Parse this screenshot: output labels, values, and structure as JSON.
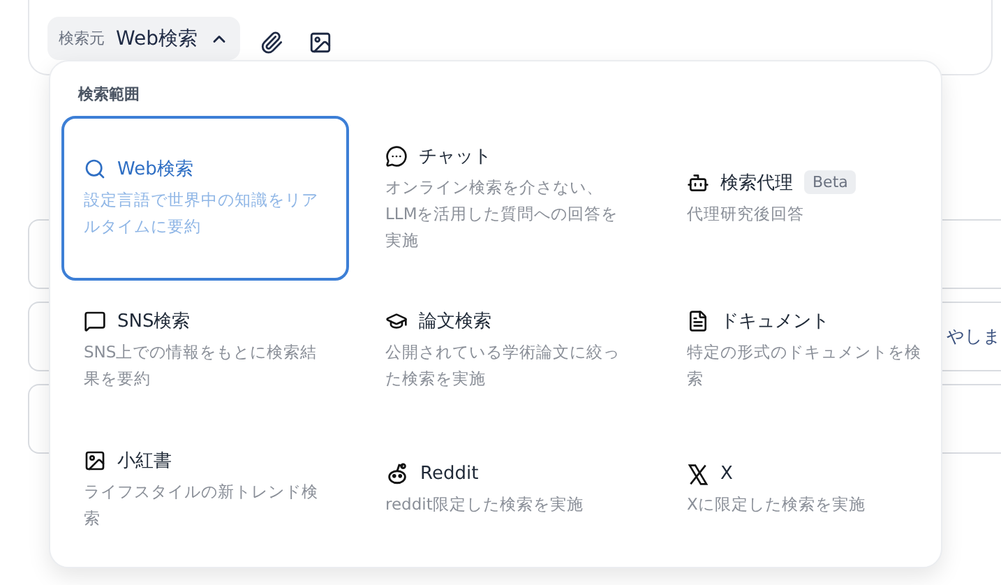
{
  "toolbar": {
    "source_label": "検索元",
    "source_value": "Web検索",
    "expanded": true
  },
  "side_text": "やしま",
  "menu": {
    "title": "検索範囲",
    "items": [
      {
        "label": "Web検索",
        "description": "設定言語で世界中の知識をリアルタイムに要約",
        "selected": true
      },
      {
        "label": "チャット",
        "description": "オンライン検索を介さない、LLMを活用した質問への回答を実施",
        "selected": false
      },
      {
        "label": "検索代理",
        "badge": "Beta",
        "description": "代理研究後回答",
        "selected": false
      },
      {
        "label": "SNS検索",
        "description": "SNS上での情報をもとに検索結果を要約",
        "selected": false
      },
      {
        "label": "論文検索",
        "description": "公開されている学術論文に絞った検索を実施",
        "selected": false
      },
      {
        "label": "ドキュメント",
        "description": "特定の形式のドキュメントを検索",
        "selected": false
      },
      {
        "label": "小紅書",
        "description": "ライフスタイルの新トレンド検索",
        "selected": false
      },
      {
        "label": "Reddit",
        "description": "reddit限定した検索を実施",
        "selected": false
      },
      {
        "label": "X",
        "description": "Xに限定した検索を実施",
        "selected": false
      }
    ]
  }
}
